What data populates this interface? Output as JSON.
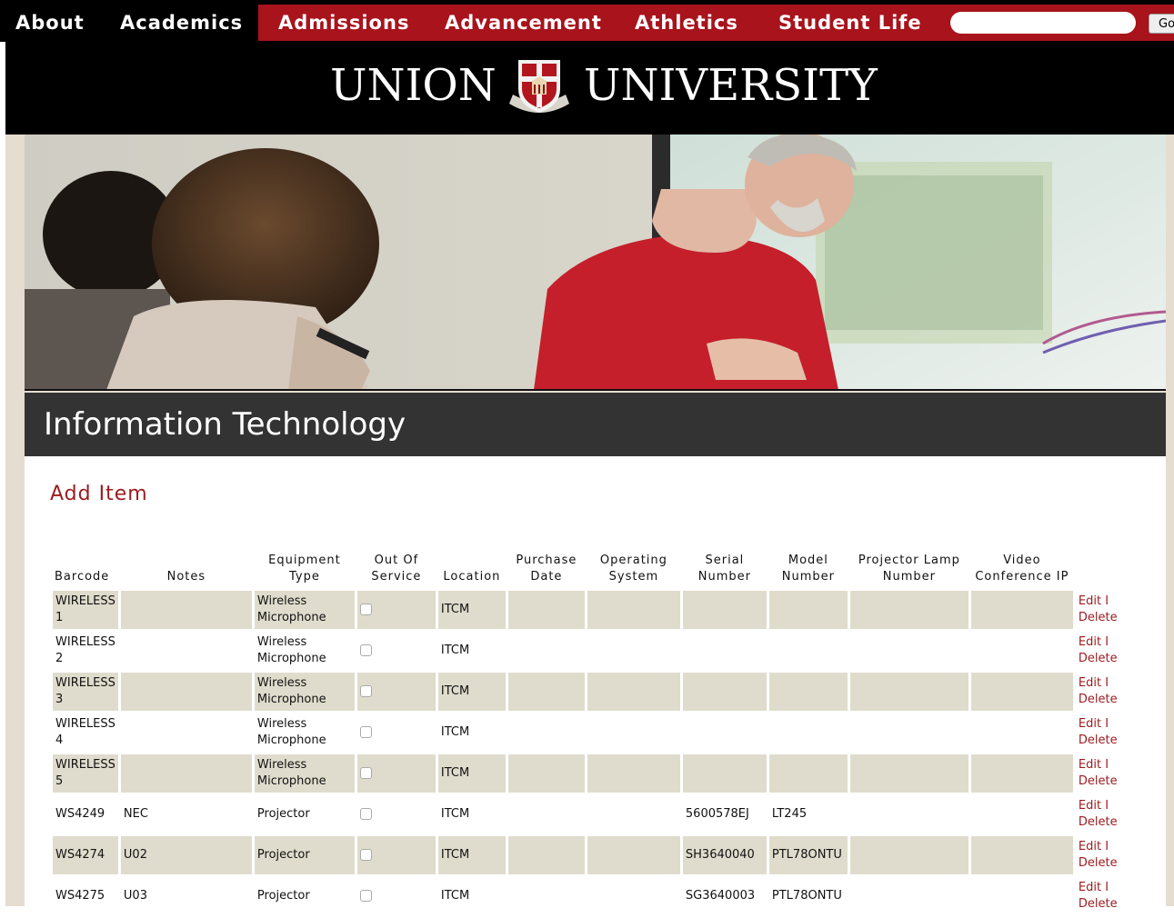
{
  "nav": {
    "items": [
      {
        "label": "About"
      },
      {
        "label": "Academics"
      },
      {
        "label": "Admissions"
      },
      {
        "label": "Advancement"
      },
      {
        "label": "Athletics"
      },
      {
        "label": "Student Life"
      }
    ],
    "search_placeholder": "",
    "go_label": "Go"
  },
  "logo": {
    "left_word": "UNION",
    "right_word": "UNIVERSITY"
  },
  "page": {
    "title": "Information Technology",
    "add_item_label": "Add Item"
  },
  "colors": {
    "nav_red": "#a8131c",
    "link_red": "#9b1b1f",
    "row_shade": "#e0dccd",
    "header_bar": "#333333"
  },
  "table": {
    "headers": {
      "barcode": "Barcode",
      "notes": "Notes",
      "equipment_type": "Equipment Type",
      "out_of_service": "Out Of Service",
      "location": "Location",
      "purchase_date": "Purchase Date",
      "operating_system": "Operating System",
      "serial_number": "Serial Number",
      "model_number": "Model Number",
      "projector_lamp_number": "Projector Lamp Number",
      "video_conference_ip": "Video Conference IP"
    },
    "edit_label": "Edit",
    "separator": "I",
    "delete_label": "Delete",
    "rows": [
      {
        "barcode": "WIRELESS 1",
        "notes": "",
        "equipment_type": "Wireless Microphone",
        "out_of_service": false,
        "location": "ITCM",
        "purchase_date": "",
        "operating_system": "",
        "serial_number": "",
        "model_number": "",
        "projector_lamp_number": "",
        "video_conference_ip": ""
      },
      {
        "barcode": "WIRELESS 2",
        "notes": "",
        "equipment_type": "Wireless Microphone",
        "out_of_service": false,
        "location": "ITCM",
        "purchase_date": "",
        "operating_system": "",
        "serial_number": "",
        "model_number": "",
        "projector_lamp_number": "",
        "video_conference_ip": ""
      },
      {
        "barcode": "WIRELESS 3",
        "notes": "",
        "equipment_type": "Wireless Microphone",
        "out_of_service": false,
        "location": "ITCM",
        "purchase_date": "",
        "operating_system": "",
        "serial_number": "",
        "model_number": "",
        "projector_lamp_number": "",
        "video_conference_ip": ""
      },
      {
        "barcode": "WIRELESS 4",
        "notes": "",
        "equipment_type": "Wireless Microphone",
        "out_of_service": false,
        "location": "ITCM",
        "purchase_date": "",
        "operating_system": "",
        "serial_number": "",
        "model_number": "",
        "projector_lamp_number": "",
        "video_conference_ip": ""
      },
      {
        "barcode": "WIRELESS 5",
        "notes": "",
        "equipment_type": "Wireless Microphone",
        "out_of_service": false,
        "location": "ITCM",
        "purchase_date": "",
        "operating_system": "",
        "serial_number": "",
        "model_number": "",
        "projector_lamp_number": "",
        "video_conference_ip": ""
      },
      {
        "barcode": "WS4249",
        "notes": "NEC",
        "equipment_type": "Projector",
        "out_of_service": false,
        "location": "ITCM",
        "purchase_date": "",
        "operating_system": "",
        "serial_number": "5600578EJ",
        "model_number": "LT245",
        "projector_lamp_number": "",
        "video_conference_ip": ""
      },
      {
        "barcode": "WS4274",
        "notes": "U02",
        "equipment_type": "Projector",
        "out_of_service": false,
        "location": "ITCM",
        "purchase_date": "",
        "operating_system": "",
        "serial_number": "SH3640040",
        "model_number": "PTL78ONTU",
        "projector_lamp_number": "",
        "video_conference_ip": ""
      },
      {
        "barcode": "WS4275",
        "notes": "U03",
        "equipment_type": "Projector",
        "out_of_service": false,
        "location": "ITCM",
        "purchase_date": "",
        "operating_system": "",
        "serial_number": "SG3640003",
        "model_number": "PTL78ONTU",
        "projector_lamp_number": "",
        "video_conference_ip": ""
      }
    ]
  }
}
